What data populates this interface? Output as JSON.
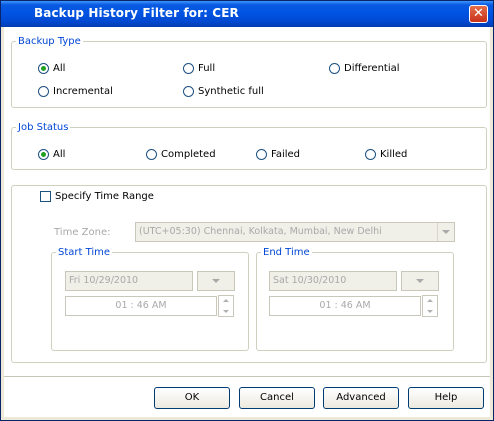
{
  "window": {
    "title": "Backup History Filter for: CER",
    "close_symbol": "✕"
  },
  "backup_type": {
    "legend": "Backup Type",
    "options": [
      {
        "label": "All",
        "selected": true
      },
      {
        "label": "Full",
        "selected": false
      },
      {
        "label": "Differential",
        "selected": false
      },
      {
        "label": "Incremental",
        "selected": false
      },
      {
        "label": "Synthetic full",
        "selected": false
      }
    ]
  },
  "job_status": {
    "legend": "Job Status",
    "options": [
      {
        "label": "All",
        "selected": true
      },
      {
        "label": "Completed",
        "selected": false
      },
      {
        "label": "Failed",
        "selected": false
      },
      {
        "label": "Killed",
        "selected": false
      }
    ]
  },
  "time_range": {
    "checkbox_label": "Specify Time Range",
    "checked": false,
    "time_zone_label": "Time Zone:",
    "time_zone_value": "(UTC+05:30) Chennai, Kolkata, Mumbai, New Delhi",
    "start": {
      "legend": "Start Time",
      "date": "Fri 10/29/2010",
      "hour": "01",
      "minute": "46 AM"
    },
    "end": {
      "legend": "End Time",
      "date": "Sat 10/30/2010",
      "hour": "01",
      "minute": "46 AM"
    },
    "time_separator": ":"
  },
  "buttons": {
    "ok": "OK",
    "cancel": "Cancel",
    "advanced": "Advanced",
    "help": "Help"
  }
}
